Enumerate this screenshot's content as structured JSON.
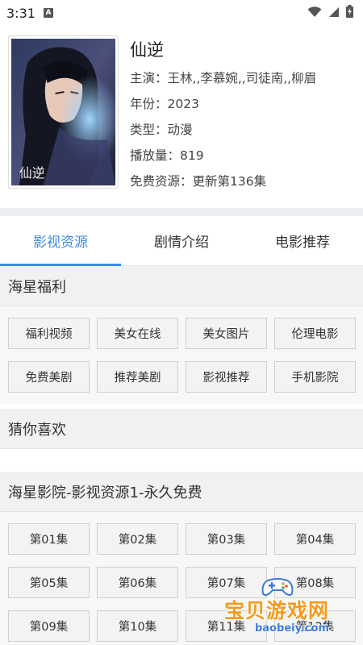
{
  "status": {
    "time": "3:31",
    "notification_icon": "A"
  },
  "movie": {
    "title": "仙逆",
    "cast": "主演：王林,,李慕婉,,司徒南,,柳眉",
    "year": "年份：2023",
    "genre": "类型：动漫",
    "plays": "播放量：819",
    "free": "免费资源：更新第136集",
    "poster_caption": "仙逆"
  },
  "tabs": [
    {
      "label": "影视资源",
      "active": true
    },
    {
      "label": "剧情介绍",
      "active": false
    },
    {
      "label": "电影推荐",
      "active": false
    }
  ],
  "welfare": {
    "heading": "海星福利",
    "items": [
      "福利视频",
      "美女在线",
      "美女图片",
      "伦理电影",
      "免费美剧",
      "推荐美剧",
      "影视推荐",
      "手机影院"
    ]
  },
  "guess": {
    "heading": "猜你喜欢"
  },
  "source": {
    "heading": "海星影院-影视资源1-永久免费",
    "episodes": [
      "第01集",
      "第02集",
      "第03集",
      "第04集",
      "第05集",
      "第06集",
      "第07集",
      "第08集",
      "第09集",
      "第10集",
      "第11集",
      "第12集"
    ]
  },
  "watermark": {
    "text": "宝贝游戏网",
    "url": "baobeiy.com"
  },
  "colors": {
    "accent": "#3c8ce7",
    "watermark_orange": "#f39a1f"
  }
}
